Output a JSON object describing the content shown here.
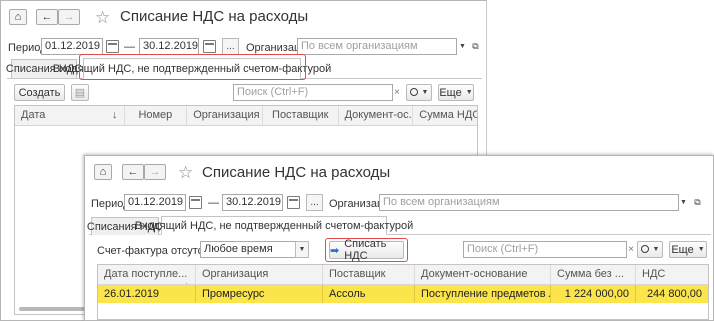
{
  "back_window": {
    "title": "Списание НДС на расходы",
    "period_label": "Период:",
    "date_from": "01.12.2019",
    "date_to": "30.12.2019",
    "dash": "—",
    "ellipsis": "...",
    "org_label": "Организация:",
    "org_placeholder": "По всем организациям",
    "tabs": [
      "Списания НДС",
      "Входящий НДС, не подтвержденный счетом-фактурой"
    ],
    "create_button": "Создать",
    "search_placeholder": "Поиск (Ctrl+F)",
    "more_button": "Еще",
    "columns": [
      "Дата",
      "Номер",
      "Организация",
      "Поставщик",
      "Документ-ос...",
      "Сумма НДС"
    ],
    "sort_arrow": "↓"
  },
  "front_window": {
    "title": "Списание НДС на расходы",
    "period_label": "Период:",
    "date_from": "01.12.2019",
    "date_to": "30.12.2019",
    "dash": "—",
    "ellipsis": "...",
    "org_label": "Организация:",
    "org_placeholder": "По всем организациям",
    "tabs": [
      "Списания НДС",
      "Входящий НДС, не подтвержденный счетом-фактурой"
    ],
    "invoice_missing_label": "Счет-фактура отсутствует:",
    "invoice_missing_value": "Любое время",
    "write_off_button": "Списать НДС",
    "search_placeholder": "Поиск (Ctrl+F)",
    "more_button": "Еще",
    "columns": [
      "Дата поступле...",
      "Организация",
      "Поставщик",
      "Документ-основание",
      "Сумма без ...",
      "НДС"
    ],
    "sort_arrow": "↓",
    "rows": [
      {
        "date": "26.01.2019",
        "org": "Промресурс",
        "supplier": "Ассоль",
        "doc": "Поступление предметов лизи...",
        "sum": "1 224 000,00",
        "vat": "244 800,00"
      }
    ]
  },
  "colors": {
    "highlight": "#e24b4b",
    "selected_row": "#fbe54b"
  }
}
